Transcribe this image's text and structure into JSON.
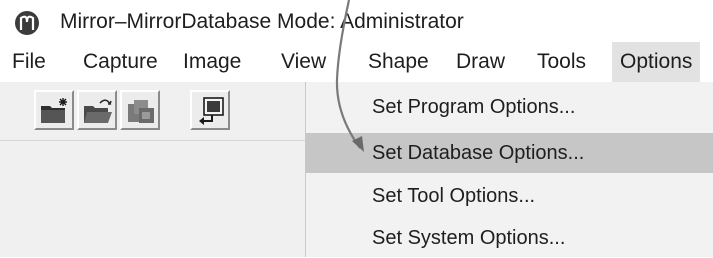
{
  "window": {
    "title": "Mirror–MirrorDatabase  Mode: Administrator",
    "icon": "mirror-app-icon"
  },
  "menubar": {
    "items": [
      {
        "label": "File"
      },
      {
        "label": "Capture"
      },
      {
        "label": "Image"
      },
      {
        "label": "View"
      },
      {
        "label": "Shape"
      },
      {
        "label": "Draw"
      },
      {
        "label": "Tools"
      },
      {
        "label": "Options",
        "active": true
      }
    ]
  },
  "toolbar": {
    "buttons": [
      {
        "icon": "new-folder-icon"
      },
      {
        "icon": "open-folder-icon"
      },
      {
        "icon": "database-icon"
      },
      {
        "icon": "import-icon"
      }
    ]
  },
  "options_menu": {
    "items": [
      {
        "label": "Set Program Options..."
      },
      {
        "label": "Set Database Options...",
        "highlighted": true
      },
      {
        "label": "Set Tool Options..."
      },
      {
        "label": "Set System Options..."
      }
    ]
  },
  "colors": {
    "highlight": "#c6c6c6",
    "menu_background": "#f2f2f2",
    "toolbar_background": "#f0f0f0",
    "annotation_arrow": "#7a7a7a"
  }
}
